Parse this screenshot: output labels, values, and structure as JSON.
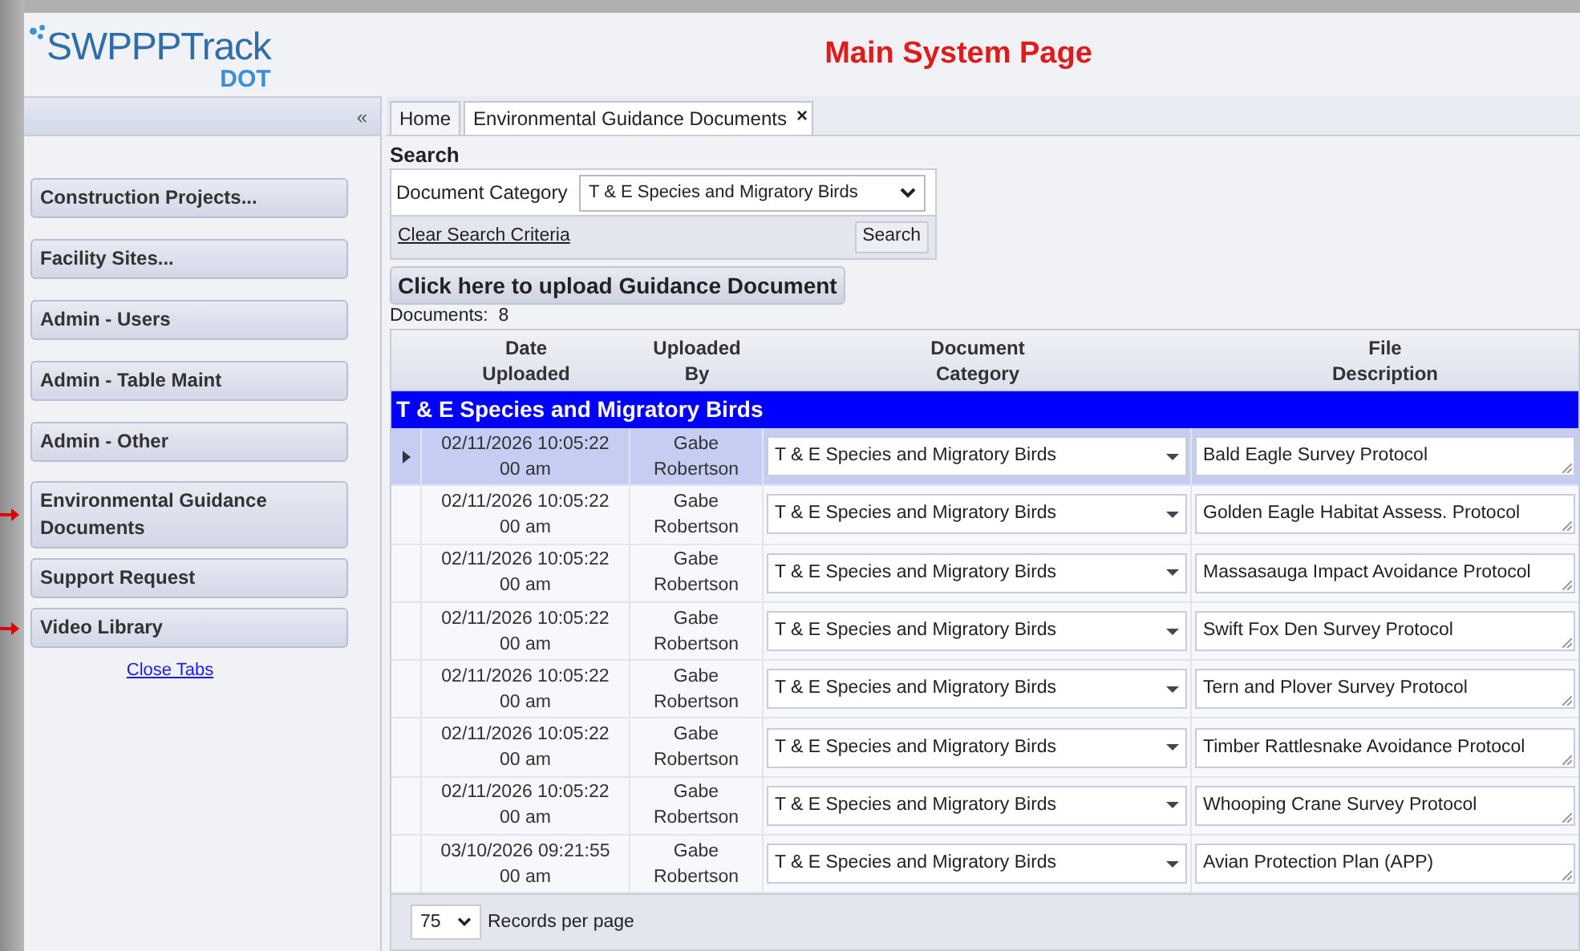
{
  "logo": {
    "name": "SWPPPTrack",
    "sub": "DOT"
  },
  "page_title": "Main System Page",
  "sidebar": {
    "collapse": "«",
    "items": [
      {
        "label": "Construction Projects...",
        "pointed": false
      },
      {
        "label": "Facility Sites...",
        "pointed": false
      },
      {
        "label": "Admin - Users",
        "pointed": false
      },
      {
        "label": "Admin - Table Maint",
        "pointed": false
      },
      {
        "label": "Admin - Other",
        "pointed": false
      },
      {
        "label": "Environmental Guidance Documents",
        "pointed": true
      },
      {
        "label": "Support Request",
        "pointed": false
      },
      {
        "label": "Video Library",
        "pointed": true
      }
    ],
    "link": "Close Tabs"
  },
  "tabs": [
    {
      "label": "Home",
      "selected": false,
      "closable": false
    },
    {
      "label": "Environmental Guidance Documents",
      "selected": true,
      "closable": true,
      "close": "×"
    }
  ],
  "search": {
    "title": "Search",
    "field_label": "Document Category",
    "value": "T & E Species and Migratory Birds",
    "clear": "Clear Search Criteria",
    "button": "Search"
  },
  "upload_button": "Click here to upload Guidance Document",
  "count": "Documents:  8",
  "table": {
    "columns": [
      "Date\nUploaded",
      "Uploaded\nBy",
      "Document\nCategory",
      "File\nDescription"
    ],
    "group": "T & E Species and Migratory Birds",
    "rows": [
      {
        "date": "02/11/2026 10:05:22\n00 am",
        "by": "Gabe\nRobertson",
        "category": "T & E Species and Migratory Birds",
        "description": "Bald Eagle Survey Protocol",
        "selected": true
      },
      {
        "date": "02/11/2026 10:05:22\n00 am",
        "by": "Gabe\nRobertson",
        "category": "T & E Species and Migratory Birds",
        "description": "Golden Eagle Habitat Assess. Protocol",
        "selected": false
      },
      {
        "date": "02/11/2026 10:05:22\n00 am",
        "by": "Gabe\nRobertson",
        "category": "T & E Species and Migratory Birds",
        "description": "Massasauga Impact Avoidance Protocol",
        "selected": false
      },
      {
        "date": "02/11/2026 10:05:22\n00 am",
        "by": "Gabe\nRobertson",
        "category": "T & E Species and Migratory Birds",
        "description": "Swift Fox Den Survey Protocol",
        "selected": false
      },
      {
        "date": "02/11/2026 10:05:22\n00 am",
        "by": "Gabe\nRobertson",
        "category": "T & E Species and Migratory Birds",
        "description": "Tern and Plover Survey Protocol",
        "selected": false
      },
      {
        "date": "02/11/2026 10:05:22\n00 am",
        "by": "Gabe\nRobertson",
        "category": "T & E Species and Migratory Birds",
        "description": "Timber Rattlesnake Avoidance Protocol",
        "selected": false
      },
      {
        "date": "02/11/2026 10:05:22\n00 am",
        "by": "Gabe\nRobertson",
        "category": "T & E Species and Migratory Birds",
        "description": "Whooping Crane Survey Protocol",
        "selected": false
      },
      {
        "date": "03/10/2026 09:21:55\n00 am",
        "by": "Gabe\nRobertson",
        "category": "T & E Species and Migratory Birds",
        "description": "Avian Protection Plan (APP)",
        "selected": false
      }
    ]
  },
  "pager": {
    "value": "75",
    "label": "Records per page"
  }
}
